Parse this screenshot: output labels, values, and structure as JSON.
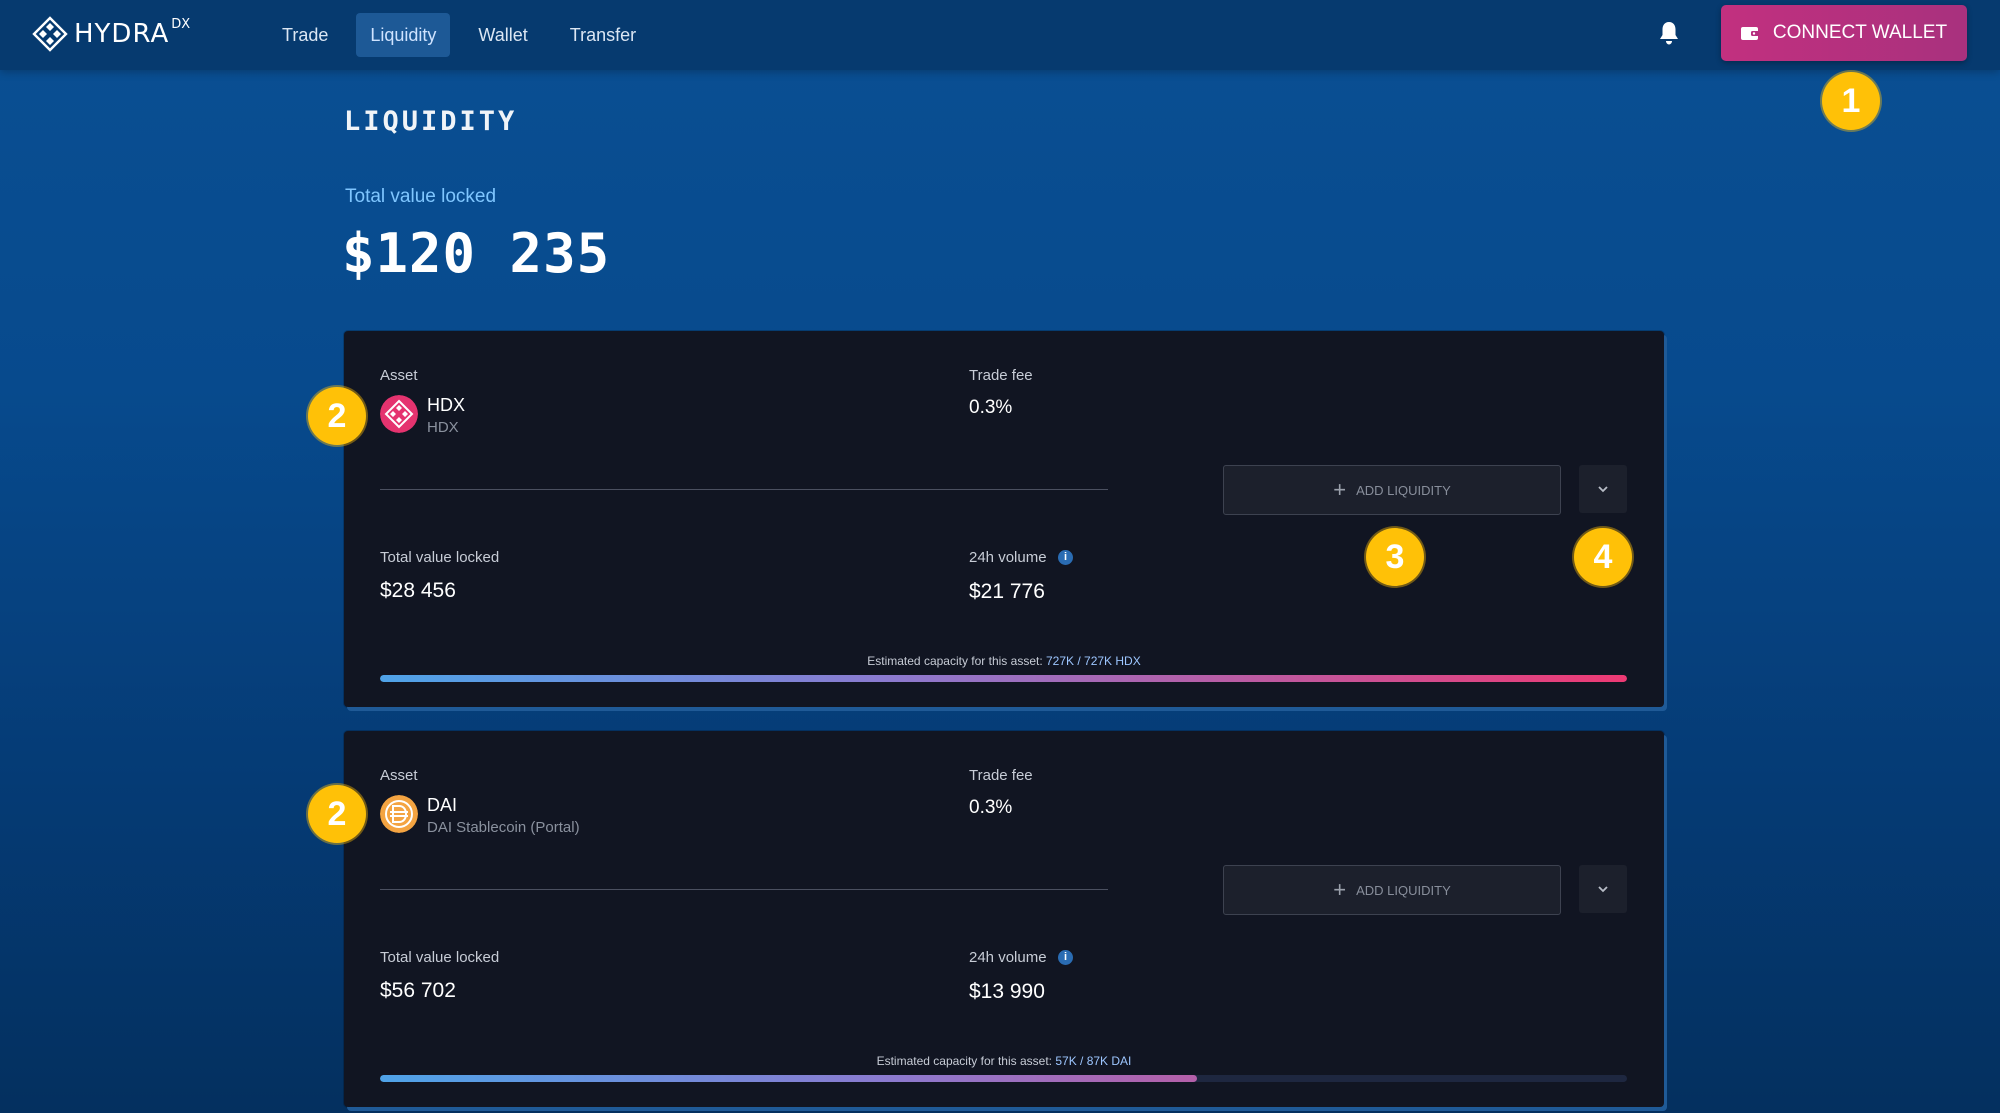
{
  "header": {
    "logo_text": "HYDRA",
    "logo_sup": "DX",
    "nav": [
      {
        "label": "Trade",
        "active": false
      },
      {
        "label": "Liquidity",
        "active": true
      },
      {
        "label": "Wallet",
        "active": false
      },
      {
        "label": "Transfer",
        "active": false
      }
    ],
    "notification_icon": "bell-icon",
    "connect_label": "CONNECT WALLET"
  },
  "page": {
    "title": "LIQUIDITY",
    "tvl_label": "Total value locked",
    "tvl_value": "$120 235"
  },
  "pools": [
    {
      "asset_label": "Asset",
      "symbol": "HDX",
      "name": "HDX",
      "icon_color": "#e5336f",
      "fee_label": "Trade fee",
      "fee": "0.3%",
      "add_label": "ADD LIQUIDITY",
      "tvl_label": "Total value locked",
      "tvl": "$28 456",
      "volume_label": "24h volume",
      "volume": "$21 776",
      "capacity_label": "Estimated capacity for this asset:",
      "capacity_value": "727K / 727K HDX",
      "capacity_fraction": 1.0
    },
    {
      "asset_label": "Asset",
      "symbol": "DAI",
      "name": "DAI Stablecoin (Portal)",
      "icon_color": "#f4a442",
      "fee_label": "Trade fee",
      "fee": "0.3%",
      "add_label": "ADD LIQUIDITY",
      "tvl_label": "Total value locked",
      "tvl": "$56 702",
      "volume_label": "24h volume",
      "volume": "$13 990",
      "capacity_label": "Estimated capacity for this asset:",
      "capacity_value": "57K / 87K DAI",
      "capacity_fraction": 0.655
    }
  ],
  "markers": [
    "1",
    "2",
    "2",
    "3",
    "4"
  ],
  "colors": {
    "accent_pink": "#c2307f",
    "bar_start": "#4fa3e8",
    "bar_end": "#ee3a74",
    "marker": "#ffc107"
  }
}
